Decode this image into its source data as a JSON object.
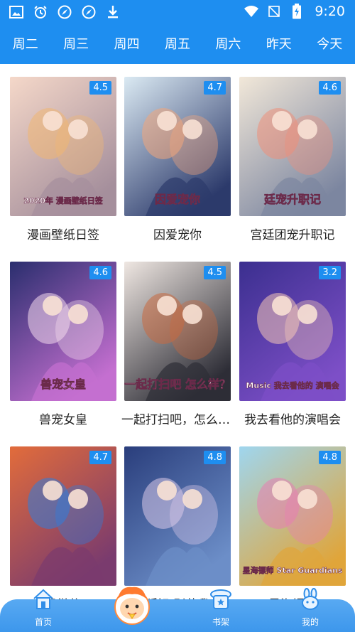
{
  "status_bar": {
    "time": "9:20",
    "left_icons": [
      "image-icon",
      "alarm-icon",
      "compass-icon",
      "compass-icon",
      "download-icon"
    ],
    "right_icons": [
      "wifi-icon",
      "no-signal-icon",
      "battery-charging-icon"
    ]
  },
  "tabs": [
    {
      "label": "周二"
    },
    {
      "label": "周三"
    },
    {
      "label": "周四"
    },
    {
      "label": "周五"
    },
    {
      "label": "周六"
    },
    {
      "label": "昨天"
    },
    {
      "label": "今天"
    }
  ],
  "comics": [
    {
      "title": "漫画壁纸日签",
      "rating": "4.5",
      "cover_text": "2020年 漫画壁纸日签",
      "colors": [
        "#f5d8c9",
        "#a58f9c",
        "#f0b673"
      ]
    },
    {
      "title": "因爱宠你",
      "rating": "4.7",
      "cover_text": "因爱宠你",
      "colors": [
        "#dbeaf3",
        "#2c3a6b",
        "#f3a57a"
      ]
    },
    {
      "title": "宫廷团宠升职记",
      "rating": "4.6",
      "cover_text": "廷宠升职记",
      "colors": [
        "#f2e8d9",
        "#7c86a0",
        "#ee8f7a"
      ]
    },
    {
      "title": "兽宠女皇",
      "rating": "4.6",
      "cover_text": "兽宠女皇",
      "colors": [
        "#2a2e6e",
        "#c46fd0",
        "#f3d9ec"
      ]
    },
    {
      "title": "一起打扫吧，怎么样？",
      "rating": "4.5",
      "cover_text": "一起打扫吧 怎么样？",
      "colors": [
        "#efe7e2",
        "#2d2d36",
        "#c86a3f"
      ]
    },
    {
      "title": "我去看他的演唱会",
      "rating": "3.2",
      "cover_text": "Music 我去看他的 演唱会",
      "colors": [
        "#3b2f8f",
        "#7d4fc7",
        "#f4c7b6"
      ]
    },
    {
      "title": "恐微信",
      "rating": "4.7",
      "cover_text": "",
      "colors": [
        "#e26c3b",
        "#7a3b6e",
        "#2f7ddd"
      ]
    },
    {
      "title": "狐妃 别惹我",
      "rating": "4.8",
      "cover_text": "",
      "colors": [
        "#2a3e7c",
        "#6c8ec8",
        "#d9c8e8"
      ]
    },
    {
      "title": "星海镖师",
      "rating": "4.8",
      "cover_text": "星海镖师 Star Guardians",
      "colors": [
        "#9fd6ef",
        "#e0a53a",
        "#e87eb3"
      ]
    }
  ],
  "bottom_nav": {
    "home": "首页",
    "shelf": "书架",
    "mine": "我的"
  },
  "accent_color": "#1e8ef0"
}
